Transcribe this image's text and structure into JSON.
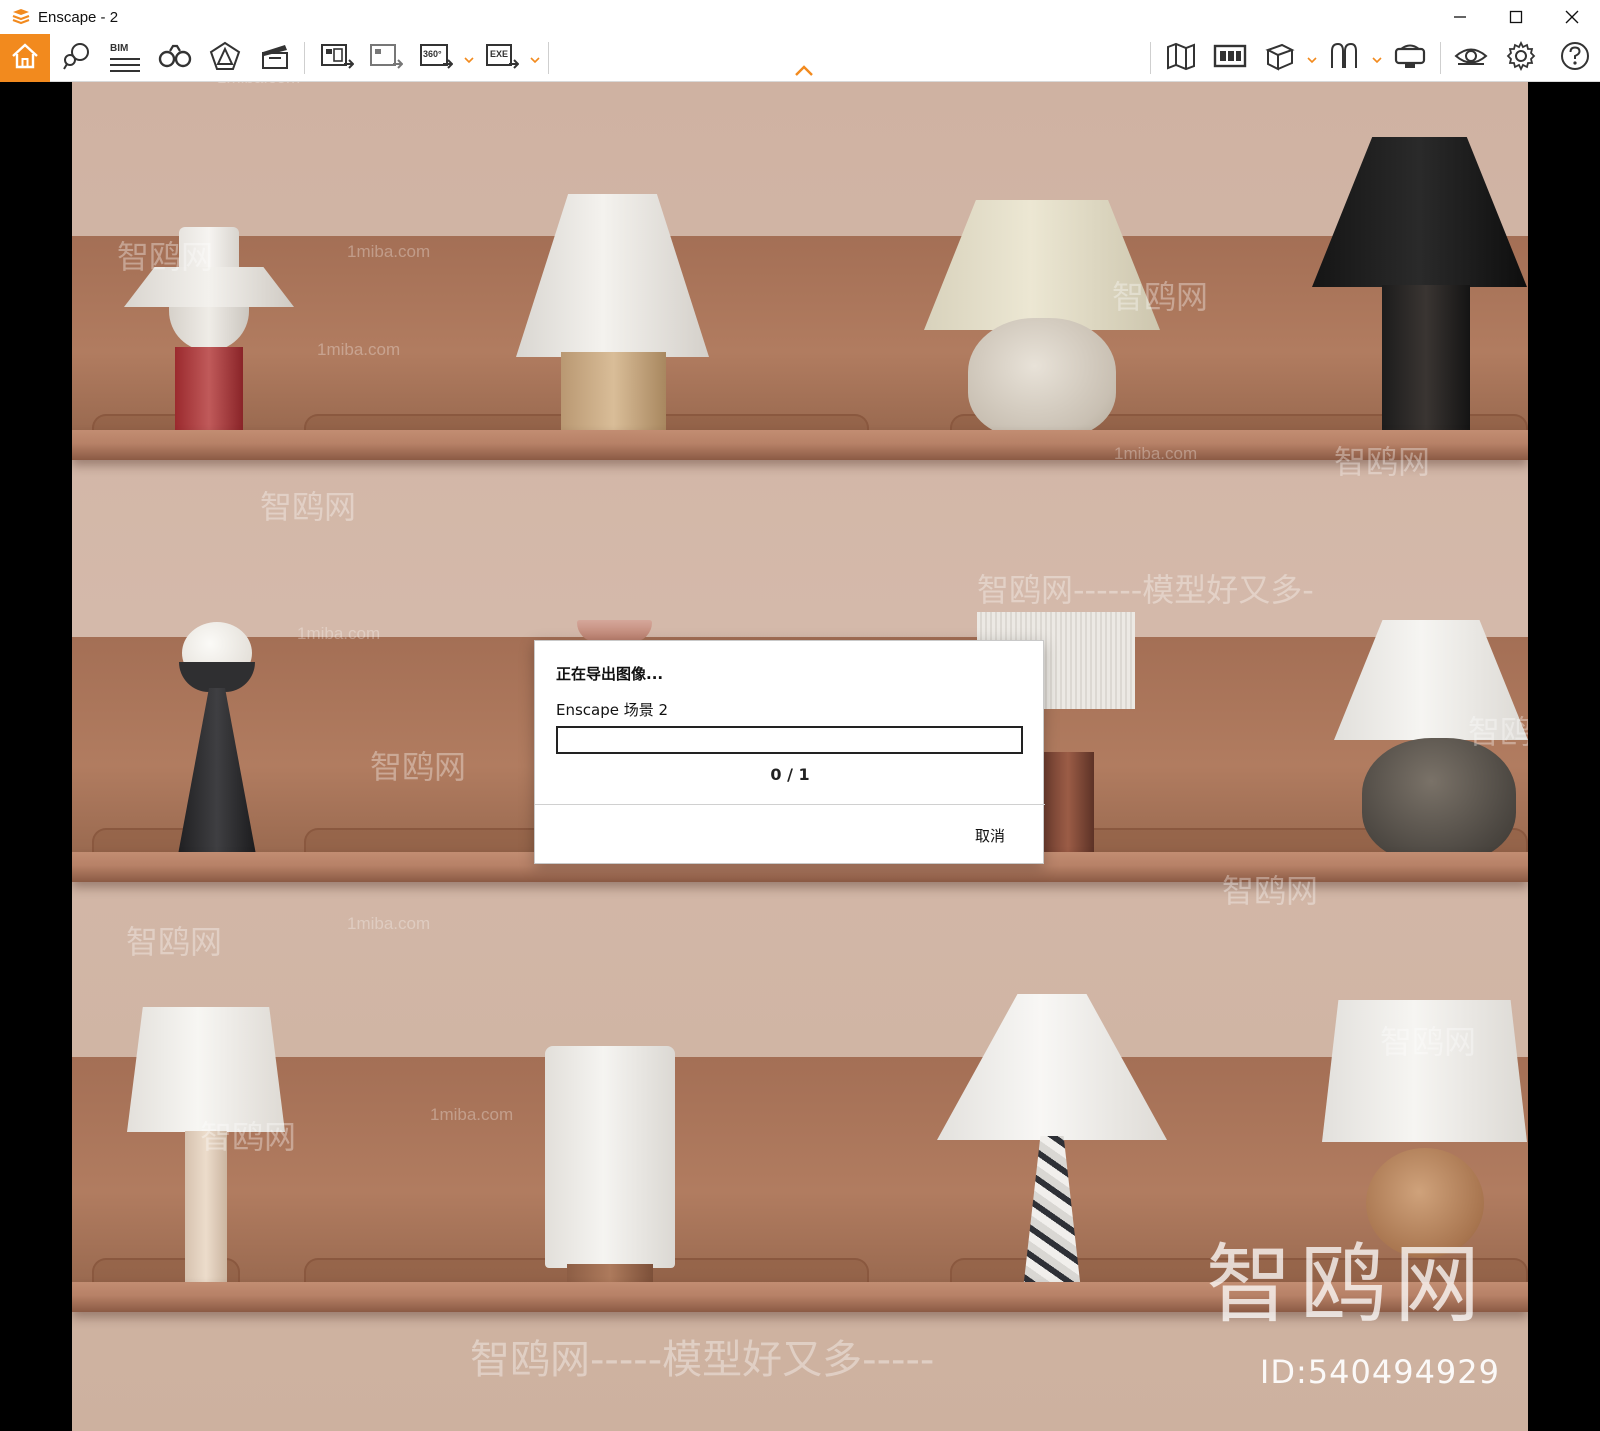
{
  "window": {
    "title": "Enscape - 2",
    "accent_color": "#f28a1e"
  },
  "toolbar": {
    "bim_label": "BIM",
    "left_icons": [
      "home-icon",
      "asset-library-icon",
      "bim-icon",
      "binoculars-icon",
      "visual-settings-icon",
      "video-editor-icon",
      "screenshot-export-icon",
      "batch-render-icon",
      "panorama-360-icon",
      "exe-export-icon"
    ],
    "panorama_label": "360°",
    "exe_label": "EXE",
    "right_icons": [
      "map-icon",
      "views-icon",
      "cube-icon",
      "collaboration-icon",
      "vr-headset-icon",
      "eye-icon",
      "gear-icon",
      "help-icon"
    ]
  },
  "dialog": {
    "heading": "正在导出图像...",
    "scene": "Enscape 场景 2",
    "progress_fraction": 0,
    "count": "0 / 1",
    "cancel_label": "取消"
  },
  "watermarks": {
    "site_short": "智鸥网",
    "site_domain": "1miba.com",
    "slogan": "智鸥网-----模型好又多-----",
    "slogan_top": "智鸥网------模型好又多-",
    "id_text": "ID:540494929",
    "big_logo": "智鸥网"
  }
}
